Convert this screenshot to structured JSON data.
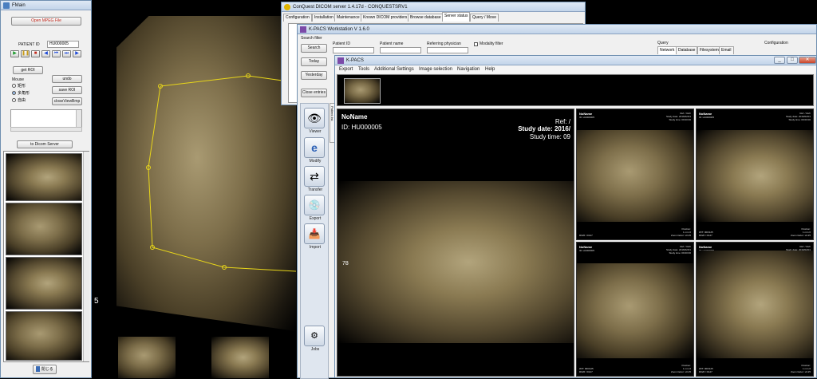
{
  "fmovie": {
    "title": "FMain",
    "open_button": "Open MPEG File",
    "patient_id_label": "PATIENT ID",
    "patient_id_value": "HU000005",
    "play_controls": [
      "play-icon",
      "pause-icon",
      "stop-icon",
      "prev-icon",
      "first-icon",
      "last-icon",
      "next-icon"
    ],
    "get_roi": "get ROI",
    "undo": "undo",
    "save_roi": "save ROI",
    "close_view": "closeViewBmp",
    "mouse_label": "Mouse",
    "mouse_options": [
      "矩形",
      "多角形",
      "自由"
    ],
    "mouse_selected": 1,
    "to_server": "to Dicom Server",
    "footer_button": "閉じる"
  },
  "conquest": {
    "title": "ConQuest DICOM server 1.4.17d - CONQUESTSRV1",
    "tabs": [
      "Configuration",
      "Installation",
      "Maintenance",
      "Known DICOM providers",
      "Browse database",
      "Server status",
      "Query / Move"
    ],
    "active_tab": 5
  },
  "workstation": {
    "title": "K-PACS Workstation V 1.6.0",
    "search_filter": "Search filter",
    "search": "Search",
    "today": "Today",
    "yesterday": "Yesterday",
    "close_entries": "Close entries",
    "patient_id": "Patient ID",
    "patient_name": "Patient name",
    "referring_physician": "Referring physician",
    "modality_filter": "Modality filter",
    "query": "Query",
    "configuration": "Configuration",
    "query_tabs": [
      "Network",
      "Database",
      "Filesystem",
      "Email"
    ],
    "side_items": [
      {
        "label": "Viewer",
        "icon": "viewer-icon",
        "glyph": "👁"
      },
      {
        "label": "Modify",
        "icon": "modify-icon",
        "glyph": "e"
      },
      {
        "label": "Transfer",
        "icon": "transfer-icon",
        "glyph": "⇄"
      },
      {
        "label": "Export",
        "icon": "export-icon",
        "glyph": "💿"
      },
      {
        "label": "Import",
        "icon": "import-icon",
        "glyph": "📥"
      }
    ],
    "jobs": "Jobs",
    "patient_list_tab": "Patient list"
  },
  "kpacs": {
    "title": "K-PACS",
    "menu": [
      "Export",
      "Tools",
      "Additional Settings",
      "Image selection",
      "Navigation",
      "Help"
    ],
    "viewer": {
      "name": "NoName",
      "id": "ID: HU000005",
      "ref": "Ref: /",
      "study_date": "Study date: 2016/",
      "study_time": "Study time: 09",
      "side_number": "78"
    },
    "tiles": [
      {
        "name": "NoName",
        "id": "ID: HU000005",
        "meta": [
          "Ref: / Refr",
          "Study date: 2016/02/01",
          "Study time: 09:00:00"
        ],
        "foot": [
          "Position:",
          "1 mm 0",
          "Zoom factor: x0.25"
        ],
        "footl": [
          "R026 / D127"
        ]
      },
      {
        "name": "NoName",
        "id": "ID: HU000005",
        "meta": [
          "Ref: / Refr",
          "Study date: 2016/02/01",
          "Study time: 09:00:00"
        ],
        "foot": [
          "Position:",
          "1 mm 0",
          "Zoom factor: x0.25"
        ],
        "footl": [
          "W/T: 000/125",
          "R026 / D127"
        ]
      },
      {
        "name": "NoName",
        "id": "ID: HU000005",
        "meta": [
          "Ref: / Refr",
          "Study date: 2016/02/01",
          "Study time: 09:00:00"
        ],
        "foot": [
          "Position:",
          "1 mm 0",
          "Zoom factor: x0.25"
        ],
        "footl": [
          "W/T: 000/125",
          "R026 / D127"
        ]
      },
      {
        "name": "NoName",
        "id": "ID: HU000005",
        "meta": [
          "Ref: / Refr",
          "Study date: 2016/02/01",
          "Study time: 09:00:00"
        ],
        "foot": [
          "Position:",
          "1 mm 0",
          "Zoom factor: x0.25"
        ],
        "footl": [
          "W/T: 000/125",
          "R026 / D127"
        ]
      }
    ]
  },
  "main_view": {
    "frame_marker": "5"
  }
}
